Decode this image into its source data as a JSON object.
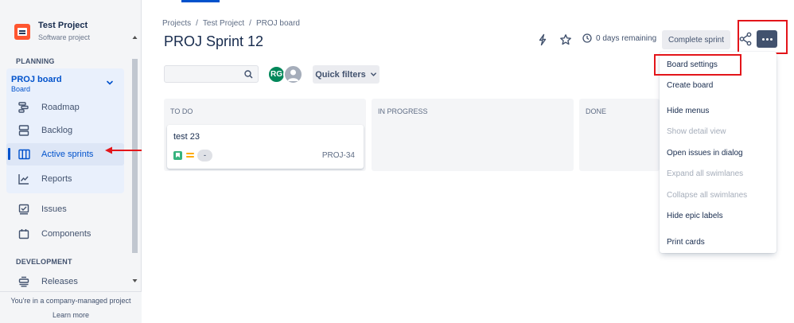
{
  "sidebar": {
    "project_name": "Test Project",
    "project_type": "Software project",
    "section_planning": "PLANNING",
    "board": {
      "title": "PROJ board",
      "subtitle": "Board"
    },
    "items": [
      {
        "label": "Roadmap",
        "icon": "roadmap-icon"
      },
      {
        "label": "Backlog",
        "icon": "backlog-icon"
      },
      {
        "label": "Active sprints",
        "icon": "board-columns-icon",
        "active": true
      },
      {
        "label": "Reports",
        "icon": "chart-line-icon"
      },
      {
        "label": "Issues",
        "icon": "issues-icon"
      },
      {
        "label": "Components",
        "icon": "components-icon"
      },
      {
        "label": "Releases",
        "icon": "ship-icon"
      }
    ],
    "section_development": "DEVELOPMENT",
    "footer_note": "You're in a company-managed project",
    "learn_more": "Learn more"
  },
  "breadcrumb": [
    "Projects",
    "/",
    "Test Project",
    "/",
    "PROJ board"
  ],
  "header": {
    "title": "PROJ Sprint 12",
    "days_remaining": "0 days remaining",
    "complete_sprint": "Complete sprint"
  },
  "filters": {
    "search_value": "",
    "avatar_initials": "RG",
    "quick_filters": "Quick filters"
  },
  "columns": [
    {
      "title": "TO DO"
    },
    {
      "title": "IN PROGRESS"
    },
    {
      "title": "DONE"
    }
  ],
  "card": {
    "title": "test 23",
    "estimate": "-",
    "key": "PROJ-34"
  },
  "menu": {
    "items": [
      {
        "label": "Board settings",
        "disabled": false
      },
      {
        "label": "Create board",
        "disabled": false
      },
      {
        "label": "Hide menus",
        "disabled": false
      },
      {
        "label": "Show detail view",
        "disabled": true
      },
      {
        "label": "Open issues in dialog",
        "disabled": false
      },
      {
        "label": "Expand all swimlanes",
        "disabled": true
      },
      {
        "label": "Collapse all swimlanes",
        "disabled": true
      },
      {
        "label": "Hide epic labels",
        "disabled": false
      },
      {
        "label": "Print cards",
        "disabled": false
      }
    ]
  },
  "colors": {
    "accent": "#0052cc",
    "highlight_red": "#e3151a",
    "avatar_green": "#00875a",
    "story_green": "#36b37e",
    "priority_yellow": "#ffab00"
  }
}
